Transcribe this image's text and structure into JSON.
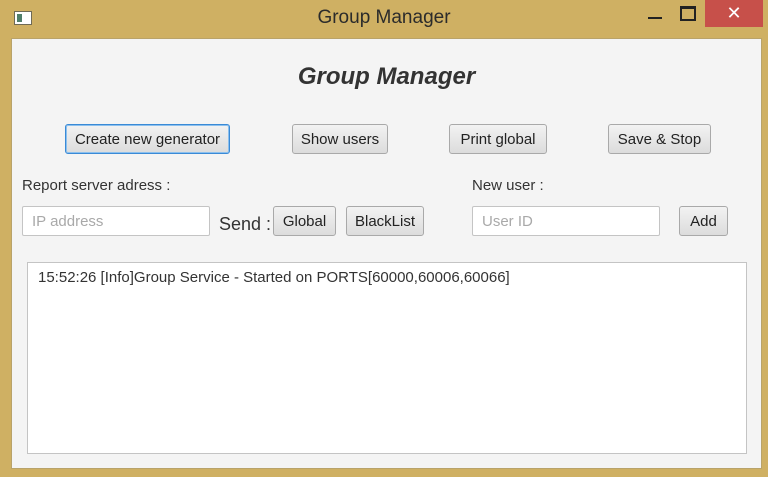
{
  "window": {
    "title": "Group Manager",
    "close_glyph": "✕",
    "accent_color": "#cfb063",
    "close_color": "#c7504a"
  },
  "main": {
    "heading": "Group Manager",
    "buttons": {
      "create_generator": "Create new generator",
      "show_users": "Show users",
      "print_global": "Print global",
      "save_stop": "Save & Stop"
    },
    "report": {
      "label": "Report server adress :",
      "ip_placeholder": "IP address",
      "ip_value": "",
      "send_label": "Send :",
      "global_button": "Global",
      "blacklist_button": "BlackList"
    },
    "new_user": {
      "label": "New user :",
      "user_placeholder": "User ID",
      "user_value": "",
      "add_button": "Add"
    },
    "log": {
      "lines": [
        "15:52:26 [Info]Group Service - Started on PORTS[60000,60006,60066]"
      ]
    }
  }
}
